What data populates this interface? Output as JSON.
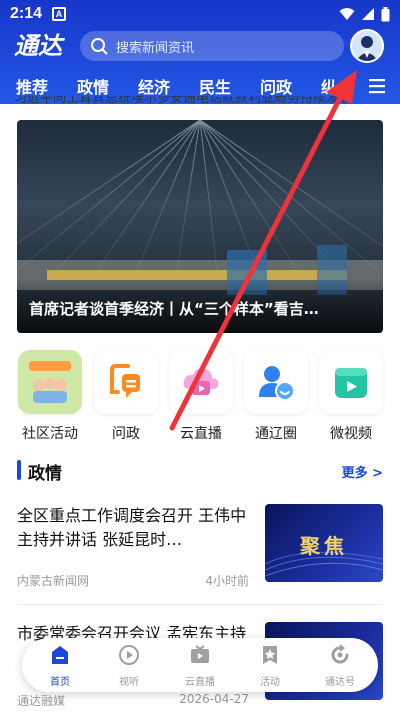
{
  "status_bar": {
    "time": "2:14",
    "badge": "A"
  },
  "header": {
    "logo_text": "通达",
    "search_placeholder": "搜索新闻资讯",
    "tabs": [
      "推荐",
      "政情",
      "经济",
      "民生",
      "问政",
      "纵"
    ],
    "accent": "#1d47d6"
  },
  "ticker": {
    "text": "习近平同土耳其总统埃尔多安通电话就叙利亚局势持续发展"
  },
  "banner": {
    "caption": "首席记者谈首季经济丨从“三个样本”看吉…"
  },
  "quick_entries": [
    {
      "label": "社区活动",
      "icon": "community-icon"
    },
    {
      "label": "问政",
      "icon": "question-icon"
    },
    {
      "label": "云直播",
      "icon": "cloud-live-icon"
    },
    {
      "label": "通辽圈",
      "icon": "circle-icon"
    },
    {
      "label": "微视频",
      "icon": "video-icon"
    }
  ],
  "section": {
    "title": "政情",
    "more": "更多 >"
  },
  "news": [
    {
      "title": "全区重点工作调度会召开 王伟中主持并讲话 张延昆时…",
      "source": "内蒙古新闻网",
      "time": "4小时前",
      "thumb_text": "聚焦"
    },
    {
      "title": "市委常委会召开会议 孟宪东主持",
      "source": "通达融媒",
      "time": "2026-04-27",
      "thumb_text": ""
    }
  ],
  "bottom_nav": [
    {
      "label": "首页",
      "icon": "home-icon",
      "active": true
    },
    {
      "label": "视听",
      "icon": "play-icon",
      "active": false
    },
    {
      "label": "云直播",
      "icon": "tv-icon",
      "active": false
    },
    {
      "label": "活动",
      "icon": "star-icon",
      "active": false
    },
    {
      "label": "通达号",
      "icon": "refresh-icon",
      "active": false
    }
  ]
}
